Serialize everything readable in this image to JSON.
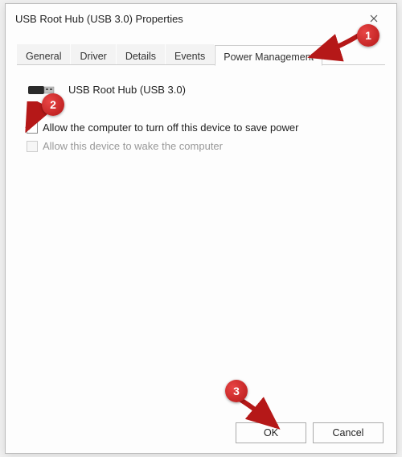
{
  "window": {
    "title": "USB Root Hub (USB 3.0) Properties"
  },
  "tabs": {
    "items": [
      "General",
      "Driver",
      "Details",
      "Events",
      "Power Management"
    ],
    "active_index": 4
  },
  "device": {
    "name": "USB Root Hub (USB 3.0)"
  },
  "options": {
    "allow_turnoff": {
      "label": "Allow the computer to turn off this device to save power",
      "checked": false,
      "enabled": true
    },
    "allow_wake": {
      "label": "Allow this device to wake the computer",
      "checked": false,
      "enabled": false
    }
  },
  "buttons": {
    "ok": "OK",
    "cancel": "Cancel"
  },
  "annotations": {
    "m1": "1",
    "m2": "2",
    "m3": "3"
  }
}
